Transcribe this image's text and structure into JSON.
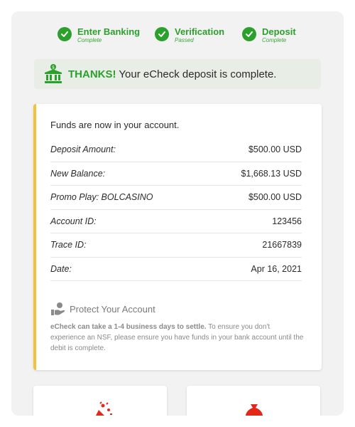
{
  "steps": [
    {
      "name": "Enter Banking",
      "status": "Complete"
    },
    {
      "name": "Verification",
      "status": "Passed"
    },
    {
      "name": "Deposit",
      "status": "Complete"
    }
  ],
  "banner": {
    "thanks": "THANKS!",
    "message": " Your eCheck deposit is complete."
  },
  "card": {
    "intro": "Funds are now in your account.",
    "rows": [
      {
        "label": "Deposit Amount:",
        "value": "$500.00 USD"
      },
      {
        "label": "New Balance:",
        "value": "$1,668.13 USD"
      },
      {
        "label": "Promo Play: BOLCASINO",
        "value": "$500.00 USD"
      },
      {
        "label": "Account ID:",
        "value": "123456"
      },
      {
        "label": "Trace ID:",
        "value": "21667839"
      },
      {
        "label": "Date:",
        "value": "Apr 16, 2021"
      }
    ],
    "protect": {
      "title": "Protect Your Account",
      "note_bold": "eCheck can take a 1-4 business days to settle.",
      "note_rest": " To ensure you don't experience an NSF, please ensure you have funds in your bank account until the debit is complete."
    }
  },
  "colors": {
    "success": "#2ca02c",
    "accent_bar": "#f3c13a",
    "icon_red": "#e3271b"
  }
}
